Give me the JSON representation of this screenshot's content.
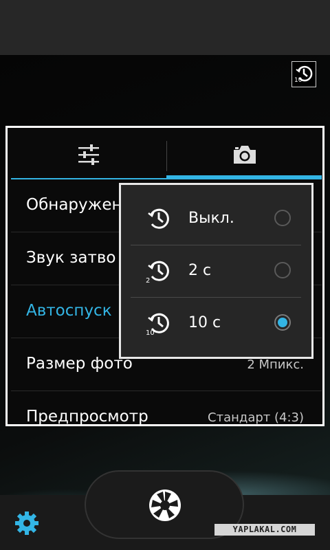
{
  "timer_indicator": {
    "value": "10"
  },
  "tabs": [
    {
      "name": "general",
      "icon": "sliders-icon",
      "selected": false
    },
    {
      "name": "camera",
      "icon": "camera-icon",
      "selected": true
    }
  ],
  "settings": {
    "rows": [
      {
        "label": "Обнаружен",
        "value": ""
      },
      {
        "label": "Звук затво",
        "value": ""
      },
      {
        "label": "Автоспуск",
        "value": ""
      },
      {
        "label": "Размер фото",
        "value": "2 Мпикс."
      },
      {
        "label": "Предпросмотр",
        "value": "Стандарт (4:3)"
      }
    ]
  },
  "timer_popup": {
    "options": [
      {
        "label": "Выкл.",
        "icon_num": "",
        "selected": false
      },
      {
        "label": "2 с",
        "icon_num": "2",
        "selected": false
      },
      {
        "label": "10 с",
        "icon_num": "10",
        "selected": true
      }
    ]
  },
  "watermark": "YAPLAKAL.COM",
  "colors": {
    "accent": "#33b5e5",
    "background": "#000000",
    "popup": "#262626"
  }
}
